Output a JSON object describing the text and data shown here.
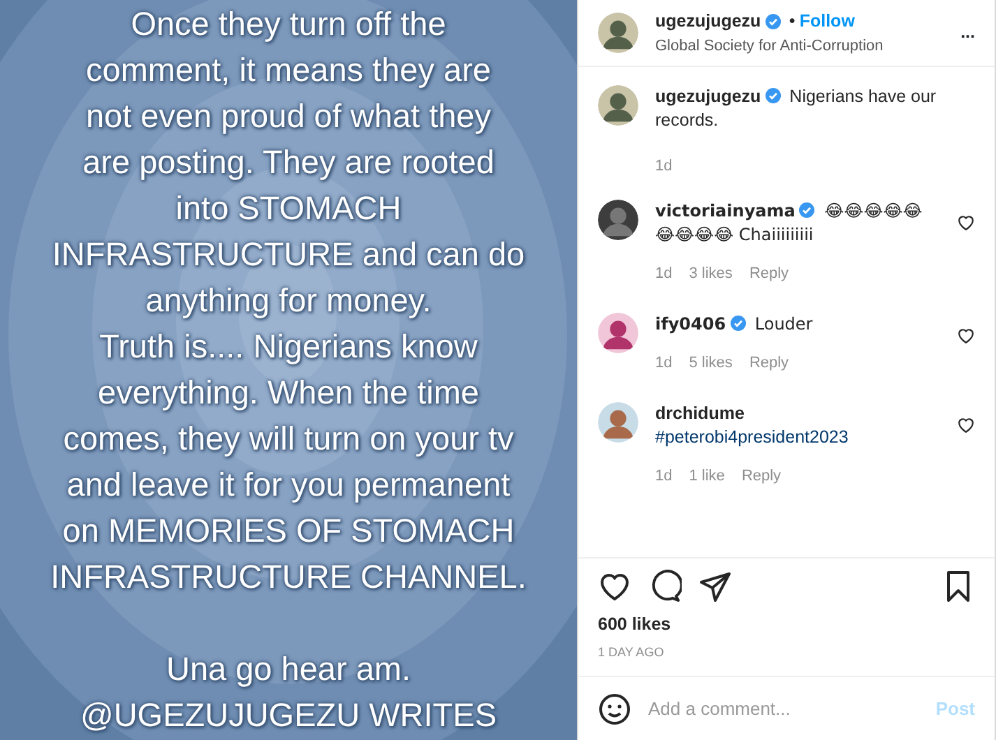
{
  "post_image": {
    "paragraphs": [
      [
        "Once they turn off the",
        "comment, it means they are",
        "not even proud of what they",
        "are posting. They are rooted",
        "into STOMACH",
        "INFRASTRUCTURE and can do",
        "anything for money.",
        "Truth is.... Nigerians know",
        "everything. When the time",
        "comes, they will turn on your tv",
        "and leave it for you permanent",
        "on MEMORIES OF STOMACH",
        "INFRASTRUCTURE CHANNEL."
      ],
      [
        "Una go hear am.",
        "@UGEZUJUGEZU WRITES"
      ]
    ]
  },
  "header": {
    "username": "ugezujugezu",
    "verified": true,
    "separator": "•",
    "follow": "Follow",
    "subtitle": "Global Society for Anti-Corruption",
    "more": "..."
  },
  "caption": {
    "username": "ugezujugezu",
    "verified": true,
    "text": "Nigerians have our records.",
    "time": "1d"
  },
  "comments": [
    {
      "username": "victoriainyama",
      "verified": true,
      "text": "😂😂😂😂😂😂😂😂😂 Chaiiiiiiiii",
      "hashtag": false,
      "time": "1d",
      "likes": "3 likes",
      "reply": "Reply"
    },
    {
      "username": "ify0406",
      "verified": true,
      "text": "Louder",
      "hashtag": false,
      "time": "1d",
      "likes": "5 likes",
      "reply": "Reply"
    },
    {
      "username": "drchidume",
      "verified": false,
      "text": "#peterobi4president2023",
      "hashtag": true,
      "time": "1d",
      "likes": "1 like",
      "reply": "Reply"
    }
  ],
  "likes": "600 likes",
  "date": "1 DAY AGO",
  "comment_box": {
    "placeholder": "Add a comment...",
    "post": "Post"
  }
}
